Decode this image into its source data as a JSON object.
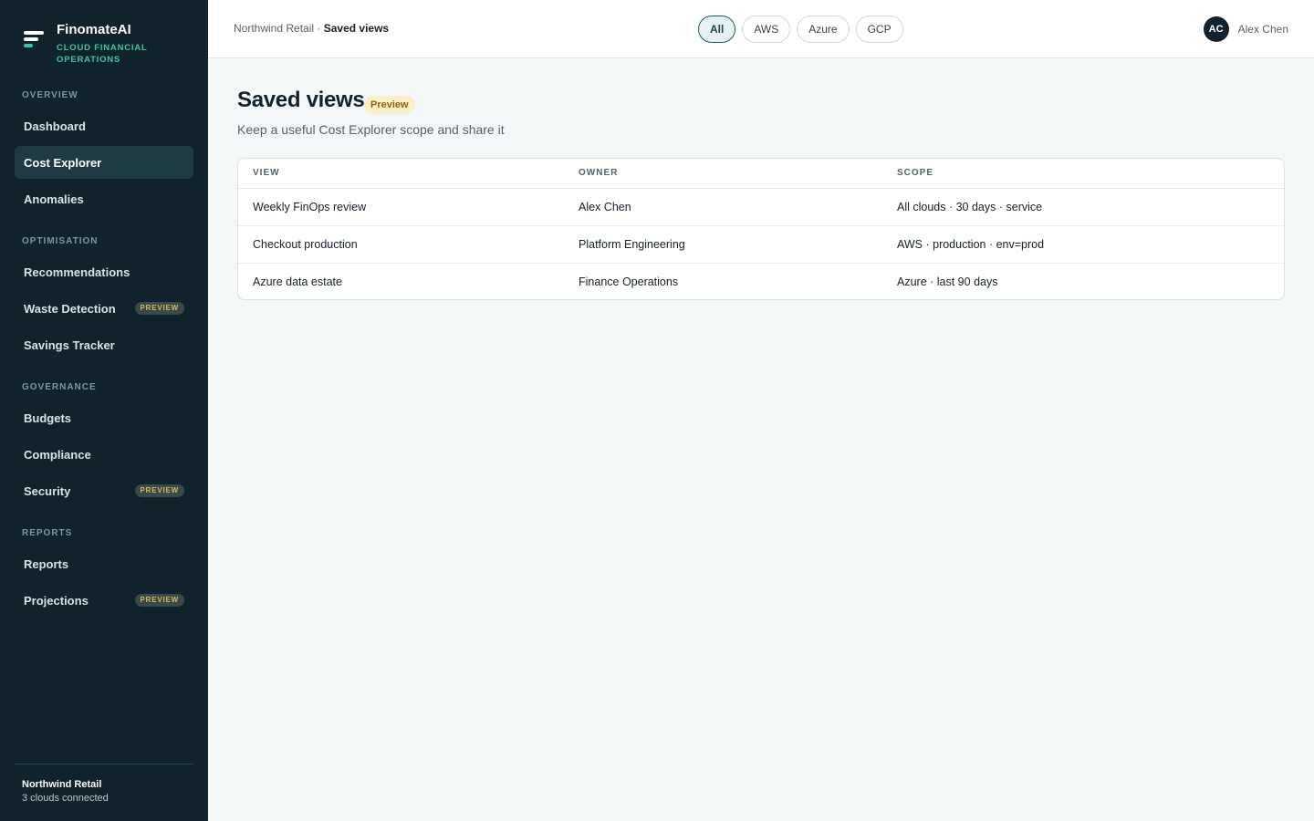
{
  "brand": {
    "name": "FinomateAI",
    "tagline": "CLOUD FINANCIAL OPERATIONS"
  },
  "sidebar": {
    "sections": {
      "overview": "OVERVIEW",
      "optimisation": "OPTIMISATION",
      "governance": "GOVERNANCE",
      "reports": "REPORTS"
    },
    "items": {
      "dashboard": "Dashboard",
      "cost_explorer": "Cost Explorer",
      "anomalies": "Anomalies",
      "recommendations": "Recommendations",
      "waste_detection": "Waste Detection",
      "savings_tracker": "Savings Tracker",
      "budgets": "Budgets",
      "compliance": "Compliance",
      "security": "Security",
      "reports": "Reports",
      "projections": "Projections"
    },
    "active_item": "Cost Explorer",
    "preview_badge": "PREVIEW",
    "footer": {
      "org": "Northwind Retail",
      "status": "3 clouds connected"
    }
  },
  "topbar": {
    "breadcrumb_parent": "Northwind Retail ·",
    "breadcrumb_current": "Saved views",
    "cloud_filters": [
      "All",
      "AWS",
      "Azure",
      "GCP"
    ],
    "active_filter": "All",
    "user_initials": "AC",
    "user_name": "Alex Chen"
  },
  "main": {
    "title": "Saved views",
    "preview_label": "Preview",
    "subtitle": "Keep a useful Cost Explorer scope and share it",
    "table": {
      "headers": [
        "VIEW",
        "OWNER",
        "SCOPE"
      ],
      "rows": [
        [
          "Weekly FinOps review",
          "Alex Chen",
          "All clouds · 30 days · service"
        ],
        [
          "Checkout production",
          "Platform Engineering",
          "AWS · production · env=prod"
        ],
        [
          "Azure data estate",
          "Finance Operations",
          "Azure · last 90 days"
        ]
      ]
    }
  },
  "colors": {
    "sidebar_bg": "#10222c",
    "accent": "#37c6a3",
    "active_nav_bg": "#1e3a45",
    "preview_bg": "#fbefc6"
  }
}
